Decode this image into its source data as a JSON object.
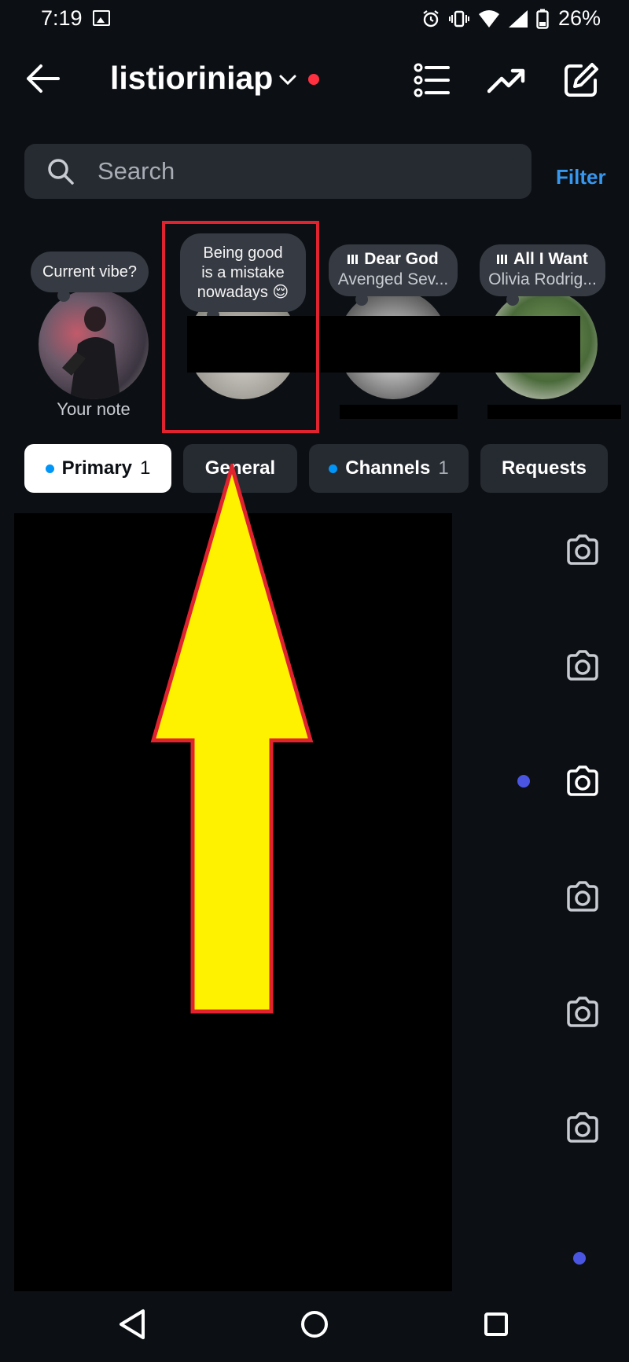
{
  "status_bar": {
    "time": "7:19",
    "battery": "26%",
    "icons": [
      "image-icon",
      "alarm-icon",
      "vibrate-icon",
      "wifi-icon",
      "signal-icon",
      "battery-icon"
    ]
  },
  "header": {
    "account_name": "listioriniap",
    "online_dot_color": "#ff3040",
    "icons": [
      "back-arrow-icon",
      "chevron-down-icon",
      "list-icon",
      "trending-icon",
      "compose-icon"
    ]
  },
  "search": {
    "placeholder": "Search",
    "filter_label": "Filter"
  },
  "notes": [
    {
      "bubble_text": "Current vibe?",
      "name": "Your note"
    },
    {
      "bubble_lines": [
        "Being good",
        "is a mistake",
        "nowadays 😌"
      ]
    },
    {
      "music_title": "Dear God",
      "music_artist": "Avenged Sev..."
    },
    {
      "music_title": "All I Want",
      "music_artist": "Olivia Rodrig..."
    }
  ],
  "tabs": [
    {
      "label": "Primary",
      "count": "1",
      "active": true,
      "dot": true
    },
    {
      "label": "General",
      "count": "",
      "active": false,
      "dot": false
    },
    {
      "label": "Channels",
      "count": "1",
      "active": false,
      "dot": true
    },
    {
      "label": "Requests",
      "count": "",
      "active": false,
      "dot": false
    }
  ],
  "threads": [
    {
      "unread": false
    },
    {
      "unread": false
    },
    {
      "unread": true
    },
    {
      "unread": false
    },
    {
      "unread": false
    },
    {
      "unread": false
    }
  ],
  "colors": {
    "background": "#0c1014",
    "accent_blue": "#3797ef",
    "highlight_red": "#e0232e",
    "annotation_arrow": "#fff200",
    "unread_dot": "#4a56e2"
  },
  "nav": [
    "back-triangle-icon",
    "home-circle-icon",
    "recents-square-icon"
  ]
}
